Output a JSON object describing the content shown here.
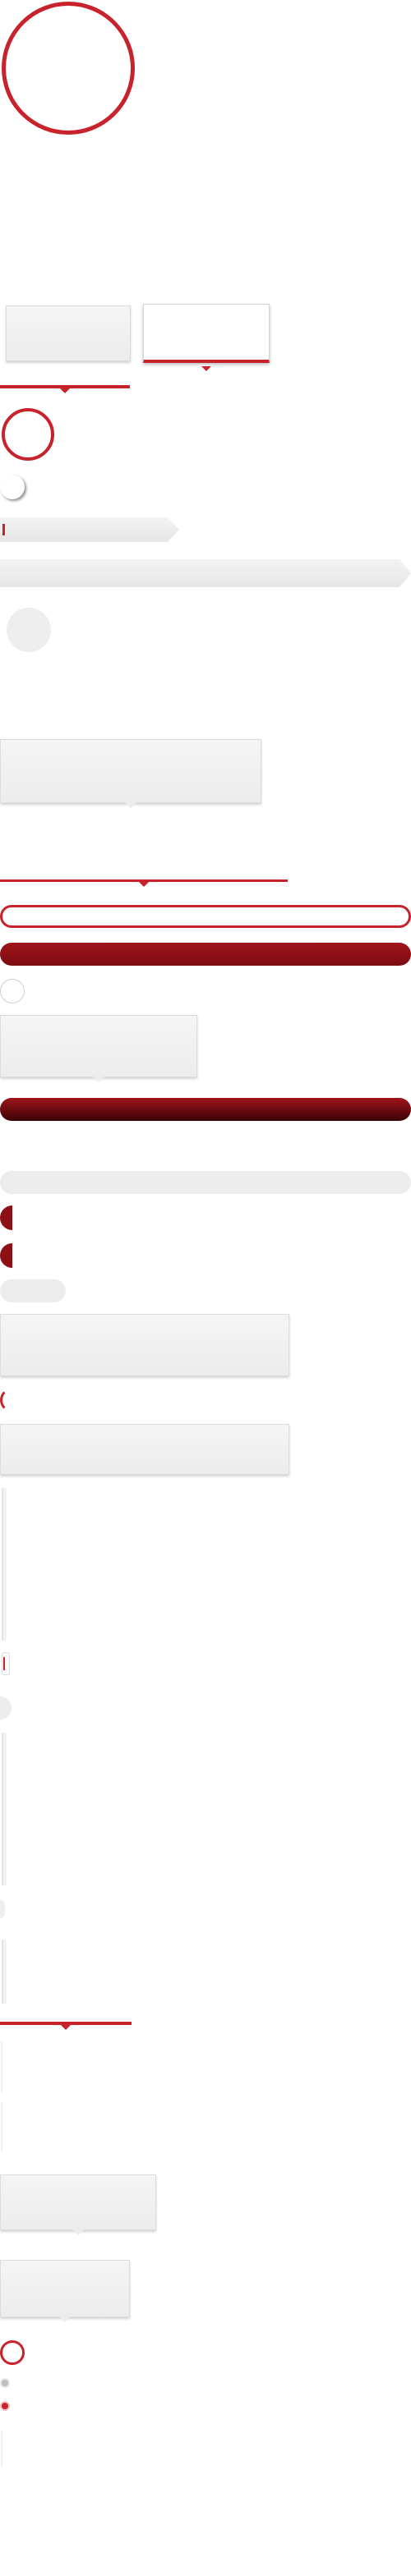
{
  "colors": {
    "accent": "#c8232c",
    "accent_dark": "#8d1016",
    "surface": "#ececec",
    "background": "#ffffff"
  },
  "tabs": [
    {
      "label": "",
      "state": "inactive"
    },
    {
      "label": "",
      "state": "active"
    }
  ]
}
